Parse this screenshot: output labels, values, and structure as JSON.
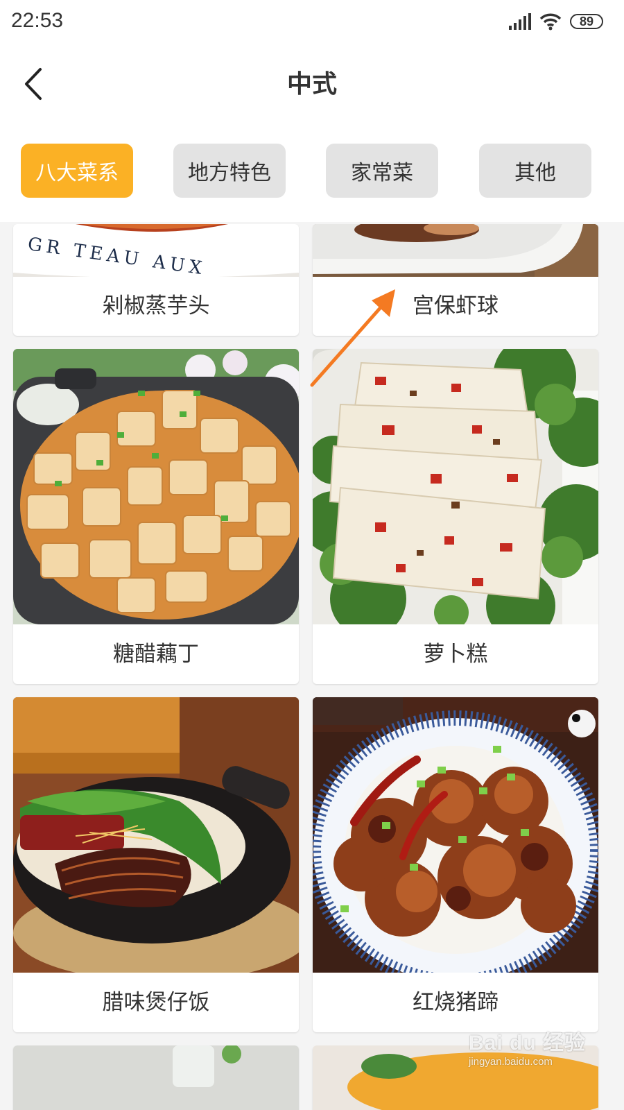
{
  "status_bar": {
    "time": "22:53",
    "battery": "89",
    "icons": [
      "signal-icon",
      "wifi-icon",
      "battery-icon"
    ]
  },
  "header": {
    "title": "中式",
    "back_icon": "chevron-left-icon"
  },
  "tabs": [
    {
      "label": "八大菜系",
      "active": true
    },
    {
      "label": "地方特色",
      "active": false
    },
    {
      "label": "家常菜",
      "active": false
    },
    {
      "label": "其他",
      "active": false
    }
  ],
  "dishes": [
    {
      "name": "剁椒蒸芋头"
    },
    {
      "name": "宫保虾球"
    },
    {
      "name": "糖醋藕丁"
    },
    {
      "name": "萝卜糕"
    },
    {
      "name": "腊味煲仔饭"
    },
    {
      "name": "红烧猪蹄"
    }
  ],
  "plate_text": "GR TEAU AUX",
  "colors": {
    "accent": "#fbb125",
    "tab_inactive": "#e3e3e3",
    "annotation_arrow": "#f47a22"
  },
  "watermark": {
    "brand": "Bai du 经验",
    "url": "jingyan.baidu.com"
  }
}
